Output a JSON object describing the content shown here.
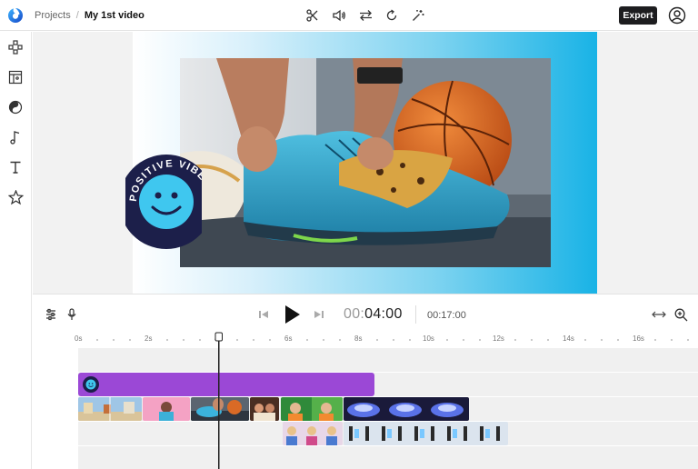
{
  "header": {
    "breadcrumb_root": "Projects",
    "breadcrumb_separator": "/",
    "project_title": "My 1st video",
    "export_label": "Export",
    "tool_icons": [
      "split-icon",
      "volume-icon",
      "swap-icon",
      "rotate-icon",
      "magic-wand-icon"
    ]
  },
  "sidebar": {
    "items": [
      "media-icon",
      "templates-icon",
      "filters-icon",
      "music-icon",
      "text-icon",
      "stickers-icon"
    ]
  },
  "preview": {
    "sticker_text": "POSITIVE VIBES"
  },
  "playback": {
    "current_time_prefix": "00:",
    "current_time_main": "04:00",
    "total_time": "00:17:00"
  },
  "timeline": {
    "ruler_labels": [
      "0s",
      "2s",
      "4s",
      "6s",
      "8s",
      "10s",
      "12s",
      "14s",
      "16s"
    ],
    "playhead_time": "4s"
  },
  "colors": {
    "accent_purple": "#9b48d6",
    "brand_blue": "#1a6fe0",
    "export_bg": "#1d1d1f"
  }
}
